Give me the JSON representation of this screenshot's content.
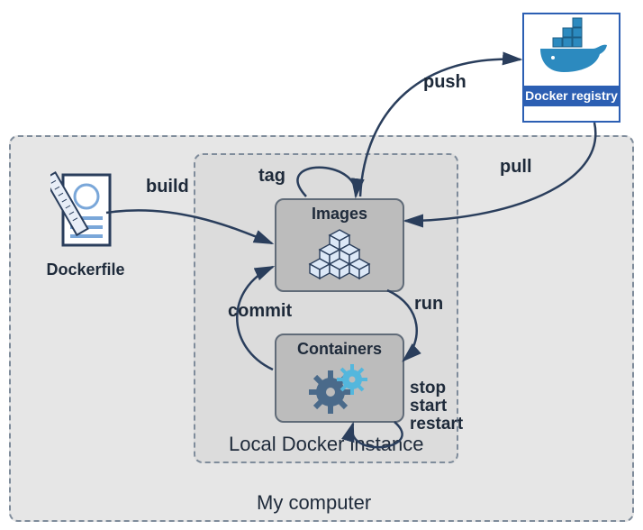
{
  "outer_box": {
    "label": "My computer"
  },
  "inner_box": {
    "label": "Local Docker instance"
  },
  "nodes": {
    "images": {
      "title": "Images",
      "icon": "cube-pyramid-icon"
    },
    "containers": {
      "title": "Containers",
      "icon": "gears-icon"
    },
    "dockerfile": {
      "title": "Dockerfile",
      "icon": "document-ruler-icon"
    },
    "registry": {
      "title": "Docker registry",
      "icon": "docker-whale-icon"
    }
  },
  "edges": {
    "build": "build",
    "tag": "tag",
    "push": "push",
    "pull": "pull",
    "run": "run",
    "commit": "commit",
    "stop": "stop",
    "start": "start",
    "restart": "restart"
  }
}
